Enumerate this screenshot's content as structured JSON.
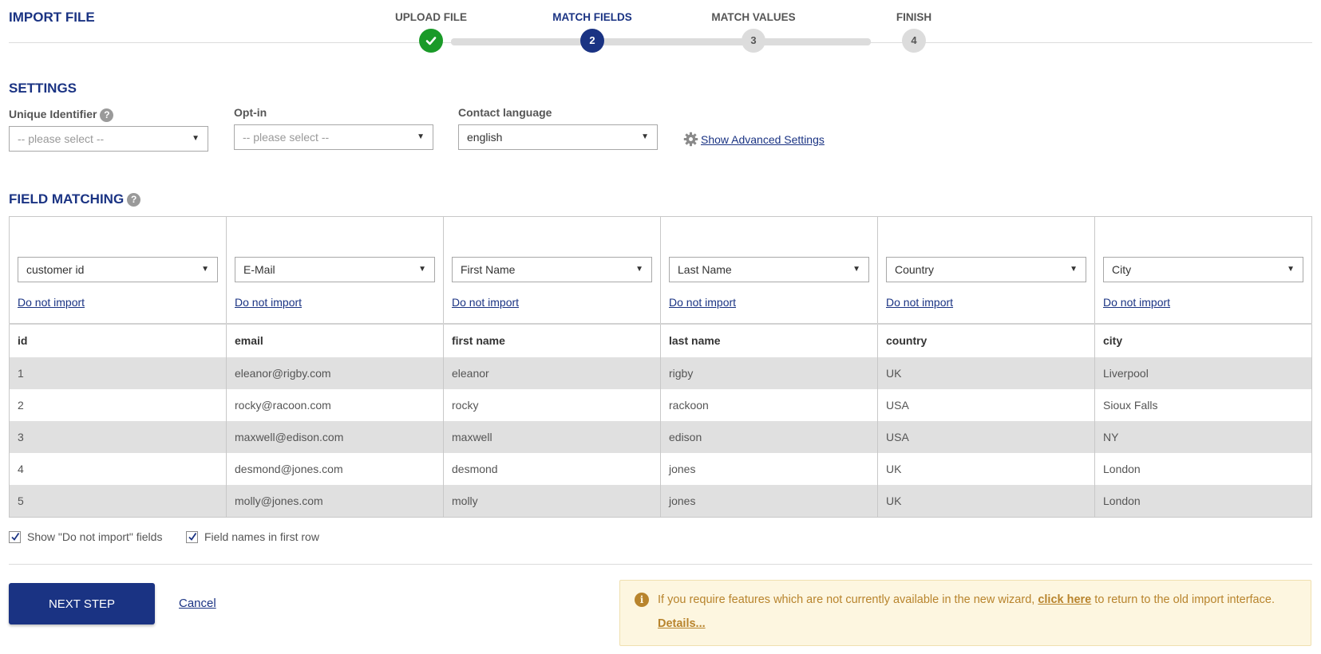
{
  "header": {
    "title": "IMPORT FILE"
  },
  "stepper": {
    "steps": [
      {
        "label": "UPLOAD FILE",
        "marker": "",
        "state": "done"
      },
      {
        "label": "MATCH FIELDS",
        "marker": "2",
        "state": "active"
      },
      {
        "label": "MATCH VALUES",
        "marker": "3",
        "state": "todo"
      },
      {
        "label": "FINISH",
        "marker": "4",
        "state": "todo"
      }
    ]
  },
  "settings": {
    "heading": "SETTINGS",
    "unique_identifier": {
      "label": "Unique Identifier",
      "value": "-- please select --"
    },
    "opt_in": {
      "label": "Opt-in",
      "value": "-- please select --"
    },
    "contact_language": {
      "label": "Contact language",
      "value": "english"
    },
    "advanced_link": "Show Advanced Settings"
  },
  "field_matching": {
    "heading": "FIELD MATCHING",
    "skip_label": "Do not import",
    "mappings": [
      "customer id",
      "E-Mail",
      "First Name",
      "Last Name",
      "Country",
      "City"
    ],
    "columns": [
      "id",
      "email",
      "first name",
      "last name",
      "country",
      "city"
    ],
    "rows": [
      [
        "1",
        "eleanor@rigby.com",
        "eleanor",
        "rigby",
        "UK",
        "Liverpool"
      ],
      [
        "2",
        "rocky@racoon.com",
        "rocky",
        "rackoon",
        "USA",
        "Sioux Falls"
      ],
      [
        "3",
        "maxwell@edison.com",
        "maxwell",
        "edison",
        "USA",
        "NY"
      ],
      [
        "4",
        "desmond@jones.com",
        "desmond",
        "jones",
        "UK",
        "London"
      ],
      [
        "5",
        "molly@jones.com",
        "molly",
        "jones",
        "UK",
        "London"
      ]
    ]
  },
  "options": {
    "show_do_not_import": {
      "label": "Show \"Do not import\" fields",
      "checked": true
    },
    "field_names_first_row": {
      "label": "Field names in first row",
      "checked": true
    }
  },
  "actions": {
    "next_step": "NEXT STEP",
    "cancel": "Cancel"
  },
  "notice": {
    "text_before": "If you require features which are not currently available in the new wizard,",
    "link": "click here",
    "text_after": "to return to the old import interface.",
    "details": "Details..."
  },
  "colors": {
    "brand": "#1a3383",
    "success": "#1a9a28",
    "notice_text": "#b8842d",
    "notice_bg": "#fdf6e0"
  }
}
